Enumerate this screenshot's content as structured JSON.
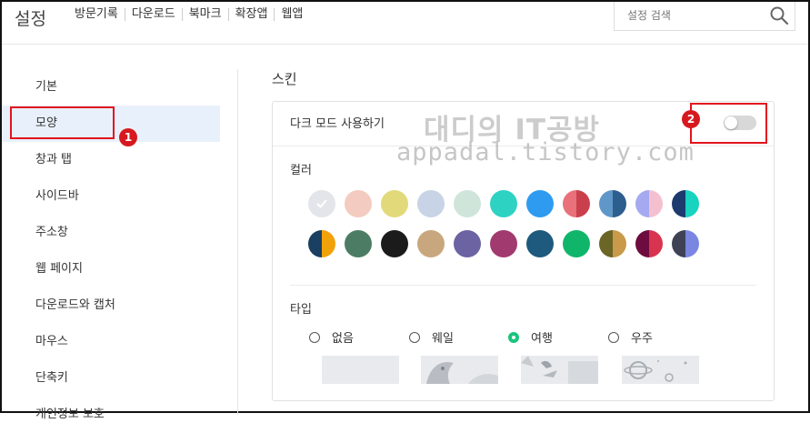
{
  "header": {
    "title": "설정",
    "nav": [
      "방문기록",
      "다운로드",
      "북마크",
      "확장앱",
      "웹앱"
    ],
    "search_placeholder": "설정 검색"
  },
  "sidebar": {
    "items": [
      {
        "label": "기본"
      },
      {
        "label": "모양",
        "active": true
      },
      {
        "label": "창과 탭"
      },
      {
        "label": "사이드바"
      },
      {
        "label": "주소창"
      },
      {
        "label": "웹 페이지"
      },
      {
        "label": "다운로드와 캡처"
      },
      {
        "label": "마우스"
      },
      {
        "label": "단축키"
      },
      {
        "label": "개인정보 보호"
      }
    ]
  },
  "skin": {
    "title": "스킨",
    "dark_mode_label": "다크 모드 사용하기",
    "dark_mode_enabled": false,
    "color_label": "컬러",
    "colors": [
      [
        "#e3e5ea"
      ],
      [
        "#f3cbc0"
      ],
      [
        "#e2d97a"
      ],
      [
        "#c8d4e6"
      ],
      [
        "#cfe5da"
      ],
      [
        "#2ed2c2"
      ],
      [
        "#2e9bf0"
      ],
      [
        "#e8717a",
        "#c9404c"
      ],
      [
        "#5e97c8",
        "#2c5f8e"
      ],
      [
        "#a5aaf0",
        "#f4c0d0"
      ],
      [
        "#1c3a6e",
        "#17d3bf"
      ],
      [
        "#1a3f60",
        "#f1a20a"
      ],
      [
        "#4c7d64"
      ],
      [
        "#1b1b1b"
      ],
      [
        "#c9a77e"
      ],
      [
        "#6c63a2"
      ],
      [
        "#a13a6f"
      ],
      [
        "#1d5a7d"
      ],
      [
        "#0fb66a"
      ],
      [
        "#6b6526",
        "#c89a4a"
      ],
      [
        "#6d0c3e",
        "#d8344f"
      ],
      [
        "#3f4255",
        "#7a86e2"
      ]
    ],
    "selected_color": 0,
    "type_label": "타입",
    "types": [
      "없음",
      "웨일",
      "여행",
      "우주"
    ],
    "selected_type": 2
  },
  "annotations": {
    "badge1": "1",
    "badge2": "2",
    "watermark_title": "대디의 IT공방",
    "watermark_url": "appadal.tistory.com"
  },
  "colors": {
    "accent_green": "#1bc47d",
    "highlight_red": "#e3131e",
    "active_bg": "#e8f1fb"
  }
}
